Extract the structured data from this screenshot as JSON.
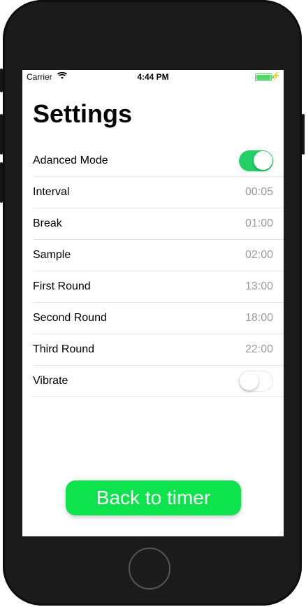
{
  "status_bar": {
    "carrier": "Carrier",
    "time": "4:44 PM",
    "wifi_icon": "wifi-icon",
    "battery_icon": "battery-icon",
    "charging_icon": "charging-bolt-icon",
    "bolt": "⚡"
  },
  "page": {
    "title": "Settings"
  },
  "settings": [
    {
      "label": "Adanced Mode",
      "type": "toggle",
      "on": true
    },
    {
      "label": "Interval",
      "type": "value",
      "value": "00:05"
    },
    {
      "label": "Break",
      "type": "value",
      "value": "01:00"
    },
    {
      "label": "Sample",
      "type": "value",
      "value": "02:00"
    },
    {
      "label": "First Round",
      "type": "value",
      "value": "13:00"
    },
    {
      "label": "Second Round",
      "type": "value",
      "value": "18:00"
    },
    {
      "label": "Third Round",
      "type": "value",
      "value": "22:00"
    },
    {
      "label": "Vibrate",
      "type": "toggle",
      "on": false
    }
  ],
  "actions": {
    "back_label": "Back to timer"
  },
  "colors": {
    "accent_green": "#0ce34c",
    "toggle_on": "#22d066",
    "value_gray": "#9b9b9b",
    "battery_green": "#4cd964"
  }
}
